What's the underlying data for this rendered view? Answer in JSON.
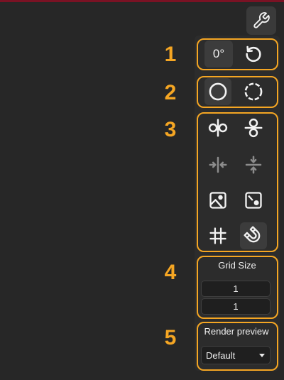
{
  "toolbar": {
    "settings_icon": "wrench-icon",
    "rotation": {
      "angle_label": "0°",
      "reset_icon": "rotate-ccw-icon"
    },
    "shape": {
      "items": [
        {
          "icon": "circle-solid-icon",
          "active": true
        },
        {
          "icon": "circle-dashed-icon",
          "active": false
        }
      ]
    },
    "transform_tools": {
      "items": [
        {
          "icon": "flip-horizontal-icon",
          "enabled": true
        },
        {
          "icon": "flip-vertical-icon",
          "enabled": true
        },
        {
          "icon": "center-horizontal-icon",
          "enabled": false
        },
        {
          "icon": "center-vertical-icon",
          "enabled": false
        },
        {
          "icon": "image-icon",
          "enabled": true
        },
        {
          "icon": "fit-image-icon",
          "enabled": true
        },
        {
          "icon": "grid-icon",
          "enabled": true
        },
        {
          "icon": "magnet-snap-icon",
          "enabled": true,
          "active": true
        }
      ]
    },
    "grid": {
      "label": "Grid Size",
      "x_value": "1",
      "y_value": "1"
    },
    "render_preview": {
      "label": "Render preview",
      "selected": "Default"
    }
  },
  "annotations": {
    "color": "#f5a623",
    "numbers": [
      "1",
      "2",
      "3",
      "4",
      "5"
    ]
  },
  "colors": {
    "background": "#272727",
    "top_accent": "#7a1224",
    "highlight": "#f5a623"
  }
}
